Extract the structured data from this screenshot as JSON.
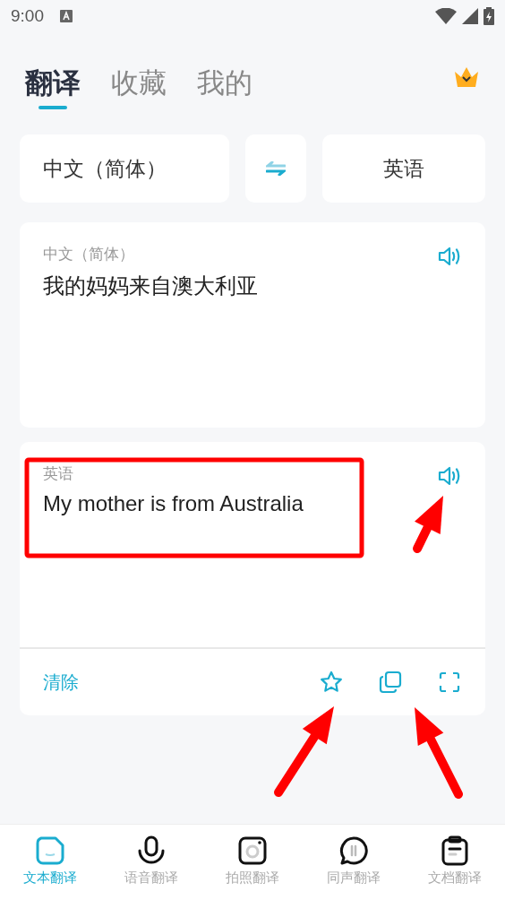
{
  "status_bar": {
    "time": "9:00"
  },
  "tabs": [
    {
      "label": "翻译",
      "selected": true
    },
    {
      "label": "收藏",
      "selected": false
    },
    {
      "label": "我的",
      "selected": false
    }
  ],
  "language_bar": {
    "source": "中文（简体）",
    "target": "英语"
  },
  "source_card": {
    "language": "中文（简体）",
    "text": "我的妈妈来自澳大利亚"
  },
  "result_card": {
    "language": "英语",
    "text": "My mother is from Australia",
    "clear": "清除"
  },
  "bottom_nav": [
    {
      "label": "文本翻译",
      "selected": true
    },
    {
      "label": "语音翻译",
      "selected": false
    },
    {
      "label": "拍照翻译",
      "selected": false
    },
    {
      "label": "同声翻译",
      "selected": false
    },
    {
      "label": "文档翻译",
      "selected": false
    }
  ]
}
